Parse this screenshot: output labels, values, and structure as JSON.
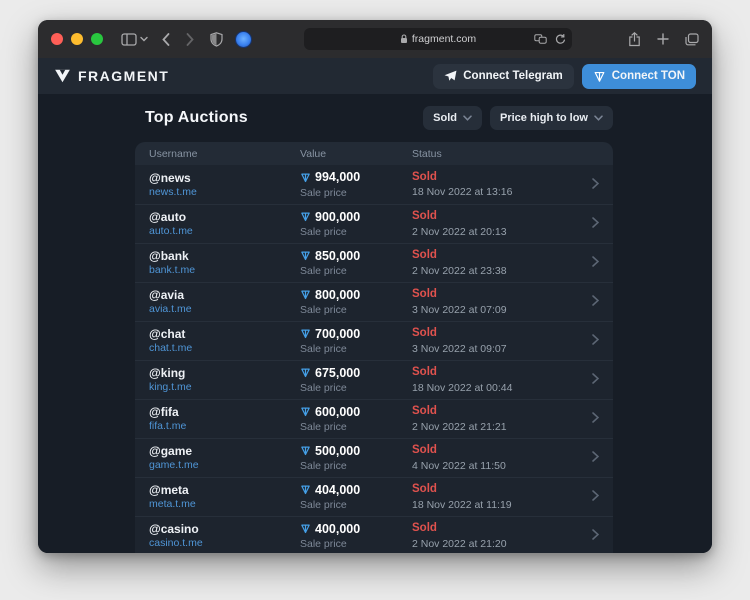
{
  "browser": {
    "url": "fragment.com"
  },
  "header": {
    "logo": "FRAGMENT",
    "connect_telegram_label": "Connect Telegram",
    "connect_ton_label": "Connect TON"
  },
  "main": {
    "title": "Top Auctions",
    "filters": {
      "status_filter": "Sold",
      "sort_filter": "Price high to low"
    }
  },
  "table": {
    "columns": [
      "Username",
      "Value",
      "Status"
    ],
    "rows": [
      {
        "username": "@news",
        "link": "news.t.me",
        "value": "994,000",
        "value_sub": "Sale price",
        "status": "Sold",
        "status_date": "18 Nov 2022 at 13:16"
      },
      {
        "username": "@auto",
        "link": "auto.t.me",
        "value": "900,000",
        "value_sub": "Sale price",
        "status": "Sold",
        "status_date": "2 Nov 2022 at 20:13"
      },
      {
        "username": "@bank",
        "link": "bank.t.me",
        "value": "850,000",
        "value_sub": "Sale price",
        "status": "Sold",
        "status_date": "2 Nov 2022 at 23:38"
      },
      {
        "username": "@avia",
        "link": "avia.t.me",
        "value": "800,000",
        "value_sub": "Sale price",
        "status": "Sold",
        "status_date": "3 Nov 2022 at 07:09"
      },
      {
        "username": "@chat",
        "link": "chat.t.me",
        "value": "700,000",
        "value_sub": "Sale price",
        "status": "Sold",
        "status_date": "3 Nov 2022 at 09:07"
      },
      {
        "username": "@king",
        "link": "king.t.me",
        "value": "675,000",
        "value_sub": "Sale price",
        "status": "Sold",
        "status_date": "18 Nov 2022 at 00:44"
      },
      {
        "username": "@fifa",
        "link": "fifa.t.me",
        "value": "600,000",
        "value_sub": "Sale price",
        "status": "Sold",
        "status_date": "2 Nov 2022 at 21:21"
      },
      {
        "username": "@game",
        "link": "game.t.me",
        "value": "500,000",
        "value_sub": "Sale price",
        "status": "Sold",
        "status_date": "4 Nov 2022 at 11:50"
      },
      {
        "username": "@meta",
        "link": "meta.t.me",
        "value": "404,000",
        "value_sub": "Sale price",
        "status": "Sold",
        "status_date": "18 Nov 2022 at 11:19"
      },
      {
        "username": "@casino",
        "link": "casino.t.me",
        "value": "400,000",
        "value_sub": "Sale price",
        "status": "Sold",
        "status_date": "2 Nov 2022 at 21:20"
      }
    ]
  },
  "icons": {
    "ton_diamond": "ton-diamond",
    "telegram_plane": "telegram-plane",
    "fragment_mark": "fragment-logo"
  },
  "colors": {
    "accent_blue": "#3e8ed9",
    "ton_blue": "#45a0e8",
    "sold_red": "#e0524e",
    "link_blue": "#4f95d6",
    "header_bg": "#222933",
    "body_bg": "#171d26",
    "row_bg": "#1d242e"
  }
}
